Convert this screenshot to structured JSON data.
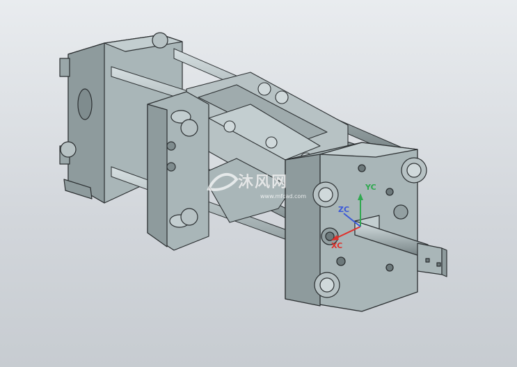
{
  "watermark": {
    "text": "沐风网",
    "url": "www.mfcad.com"
  },
  "axes": {
    "x_label": "XC",
    "y_label": "YC",
    "z_label": "ZC",
    "x_color": "#e0302a",
    "y_color": "#2fa84f",
    "z_color": "#3a58d8"
  },
  "colors": {
    "body": "#a9b6b8",
    "body_light": "#c3ced0",
    "body_dark": "#7f8c8e",
    "edge": "#2b2f31"
  },
  "icons": {
    "model": "injection-molding-machine-model",
    "triad": "coordinate-triad-icon",
    "logo": "watermark-logo-icon"
  }
}
